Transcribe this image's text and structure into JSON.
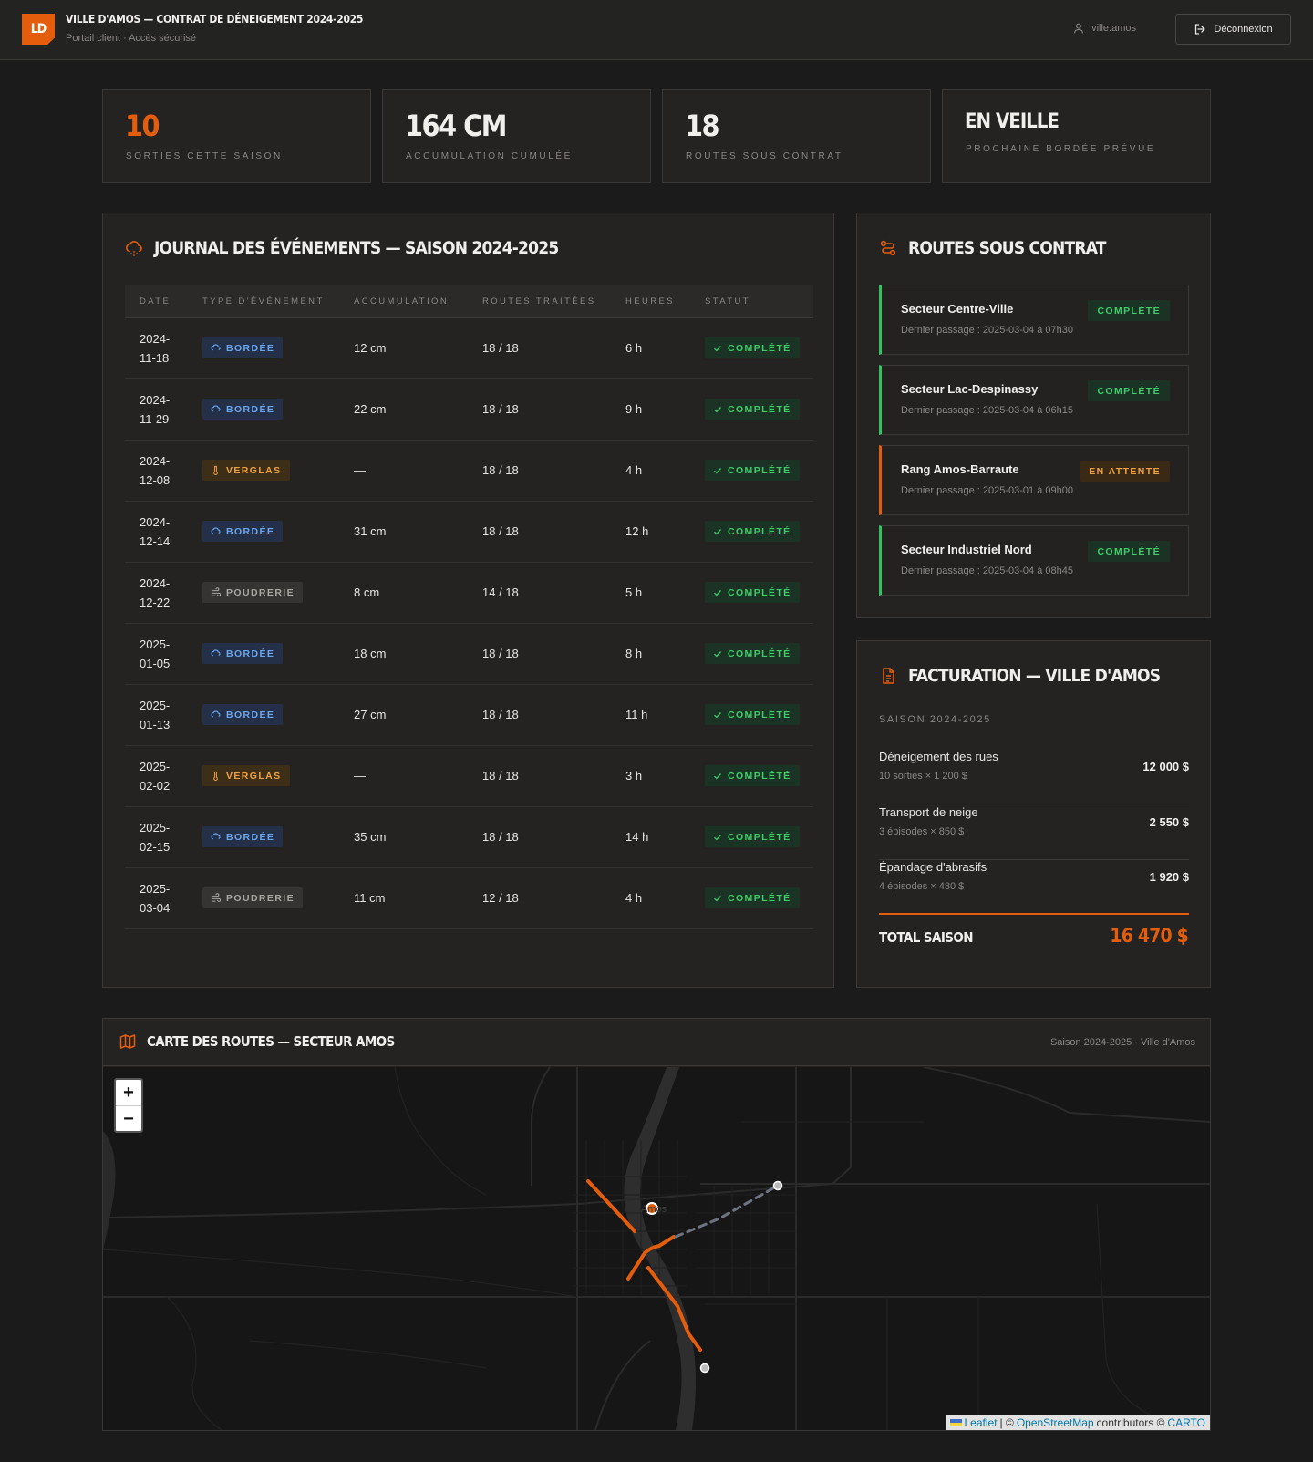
{
  "header": {
    "logo": "LD",
    "title": "VILLE D'AMOS — CONTRAT DE DÉNEIGEMENT 2024-2025",
    "subtitle": "Portail client · Accès sécurisé",
    "user": "ville.amos",
    "logout_label": "Déconnexion"
  },
  "stats": [
    {
      "value": "10",
      "label": "SORTIES CETTE SAISON"
    },
    {
      "value": "164 CM",
      "label": "ACCUMULATION CUMULÉE"
    },
    {
      "value": "18",
      "label": "ROUTES SOUS CONTRAT"
    },
    {
      "value": "EN VEILLE",
      "label": "PROCHAINE BORDÉE PRÉVUE"
    }
  ],
  "journal": {
    "title": "JOURNAL DES ÉVÉNEMENTS — SAISON 2024-2025",
    "columns": [
      "DATE",
      "TYPE D'ÉVÉNEMENT",
      "ACCUMULATION",
      "ROUTES TRAITÉES",
      "HEURES",
      "STATUT"
    ],
    "rows": [
      {
        "date": "2024-11-18",
        "type": "BORDÉE",
        "kind": "bordee",
        "accum": "12 cm",
        "routes": "18 / 18",
        "hours": "6 h",
        "status": "COMPLÉTÉ"
      },
      {
        "date": "2024-11-29",
        "type": "BORDÉE",
        "kind": "bordee",
        "accum": "22 cm",
        "routes": "18 / 18",
        "hours": "9 h",
        "status": "COMPLÉTÉ"
      },
      {
        "date": "2024-12-08",
        "type": "VERGLAS",
        "kind": "verglas",
        "accum": "—",
        "routes": "18 / 18",
        "hours": "4 h",
        "status": "COMPLÉTÉ"
      },
      {
        "date": "2024-12-14",
        "type": "BORDÉE",
        "kind": "bordee",
        "accum": "31 cm",
        "routes": "18 / 18",
        "hours": "12 h",
        "status": "COMPLÉTÉ"
      },
      {
        "date": "2024-12-22",
        "type": "POUDRERIE",
        "kind": "poudrerie",
        "accum": "8 cm",
        "routes": "14 / 18",
        "hours": "5 h",
        "status": "COMPLÉTÉ"
      },
      {
        "date": "2025-01-05",
        "type": "BORDÉE",
        "kind": "bordee",
        "accum": "18 cm",
        "routes": "18 / 18",
        "hours": "8 h",
        "status": "COMPLÉTÉ"
      },
      {
        "date": "2025-01-13",
        "type": "BORDÉE",
        "kind": "bordee",
        "accum": "27 cm",
        "routes": "18 / 18",
        "hours": "11 h",
        "status": "COMPLÉTÉ"
      },
      {
        "date": "2025-02-02",
        "type": "VERGLAS",
        "kind": "verglas",
        "accum": "—",
        "routes": "18 / 18",
        "hours": "3 h",
        "status": "COMPLÉTÉ"
      },
      {
        "date": "2025-02-15",
        "type": "BORDÉE",
        "kind": "bordee",
        "accum": "35 cm",
        "routes": "18 / 18",
        "hours": "14 h",
        "status": "COMPLÉTÉ"
      },
      {
        "date": "2025-03-04",
        "type": "POUDRERIE",
        "kind": "poudrerie",
        "accum": "11 cm",
        "routes": "12 / 18",
        "hours": "4 h",
        "status": "COMPLÉTÉ"
      }
    ]
  },
  "routes": {
    "title": "ROUTES SOUS CONTRAT",
    "items": [
      {
        "name": "Secteur Centre-Ville",
        "last": "Dernier passage : 2025-03-04 à 07h30",
        "status": "COMPLÉTÉ",
        "state": "ok"
      },
      {
        "name": "Secteur Lac-Despinassy",
        "last": "Dernier passage : 2025-03-04 à 06h15",
        "status": "COMPLÉTÉ",
        "state": "ok"
      },
      {
        "name": "Rang Amos-Barraute",
        "last": "Dernier passage : 2025-03-01 à 09h00",
        "status": "EN ATTENTE",
        "state": "pending"
      },
      {
        "name": "Secteur Industriel Nord",
        "last": "Dernier passage : 2025-03-04 à 08h45",
        "status": "COMPLÉTÉ",
        "state": "ok"
      }
    ]
  },
  "billing": {
    "title": "FACTURATION — VILLE D'AMOS",
    "season": "SAISON 2024-2025",
    "lines": [
      {
        "name": "Déneigement des rues",
        "detail": "10 sorties × 1 200 $",
        "amount": "12 000 $"
      },
      {
        "name": "Transport de neige",
        "detail": "3 épisodes × 850 $",
        "amount": "2 550 $"
      },
      {
        "name": "Épandage d'abrasifs",
        "detail": "4 épisodes × 480 $",
        "amount": "1 920 $"
      }
    ],
    "total_label": "TOTAL SAISON",
    "total": "16 470 $"
  },
  "map": {
    "title": "CARTE DES ROUTES — SECTEUR AMOS",
    "meta": "Saison 2024-2025 · Ville d'Amos",
    "city_label": "Amos",
    "zoom_in": "+",
    "zoom_out": "−",
    "attribution": {
      "leaflet": "Leaflet",
      "sep1": "| ©",
      "osm": "OpenStreetMap",
      "contrib": "contributors ©",
      "carto": "CARTO"
    }
  },
  "colors": {
    "accent": "#e35d0c",
    "ok": "#3fcd6a",
    "pending": "#f0a23e",
    "bordee": "#6aa7f0"
  },
  "icons": {
    "logout": "logout-icon",
    "user": "user-icon",
    "journal": "snow-cloud-icon",
    "routes": "route-icon",
    "billing": "document-icon",
    "map": "map-icon"
  }
}
